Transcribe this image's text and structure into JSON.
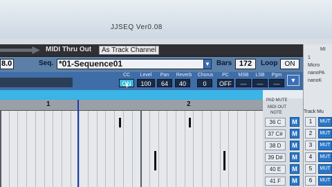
{
  "window": {
    "title": "JJSEQ  Ver0.08"
  },
  "midi_thru": {
    "label": "MIDI Thru Out",
    "value": "As Track Channel"
  },
  "right_panel": {
    "header": "MI",
    "items": [
      "1",
      "Micro",
      "nanoPA",
      "nanoK"
    ]
  },
  "sequence": {
    "tempo_value": "8.0",
    "seq_label": "Seq.",
    "selected": "*01-Sequence01",
    "bars_label": "Bars",
    "bars_value": "172",
    "loop_label": "Loop",
    "loop_value": "ON"
  },
  "controls": [
    {
      "header": "CC",
      "value": "ON"
    },
    {
      "header": "Level",
      "value": "100"
    },
    {
      "header": "Pan",
      "value": "64"
    },
    {
      "header": "Reverb",
      "value": "40"
    },
    {
      "header": "Chorus",
      "value": "0"
    },
    {
      "header": "PC",
      "value": "OFF"
    },
    {
      "header": "MSB",
      "value": "—"
    },
    {
      "header": "LSB",
      "value": "—"
    },
    {
      "header": "Pgm",
      "value": "—"
    }
  ],
  "ruler": {
    "bars": [
      "1",
      "2"
    ]
  },
  "pad_panel": {
    "header_line1": "PAD MUTE",
    "header_line2": "MIDI OUT",
    "header_line3": "NOTE",
    "keys": [
      {
        "note": "36 C",
        "mute": "M"
      },
      {
        "note": "37 C#",
        "mute": "M"
      },
      {
        "note": "38 D",
        "mute": "M"
      },
      {
        "note": "39 D#",
        "mute": "M"
      },
      {
        "note": "40 E",
        "mute": "M"
      },
      {
        "note": "41 F",
        "mute": "M"
      }
    ]
  },
  "tracks": {
    "header": "Track  Mu",
    "rows": [
      {
        "num": "1",
        "mute": "MUT"
      },
      {
        "num": "2",
        "mute": "MUT"
      },
      {
        "num": "3",
        "mute": "MUT"
      },
      {
        "num": "4",
        "mute": "MUT"
      },
      {
        "num": "5",
        "mute": "MUT"
      },
      {
        "num": "6",
        "mute": "MUT"
      }
    ]
  }
}
